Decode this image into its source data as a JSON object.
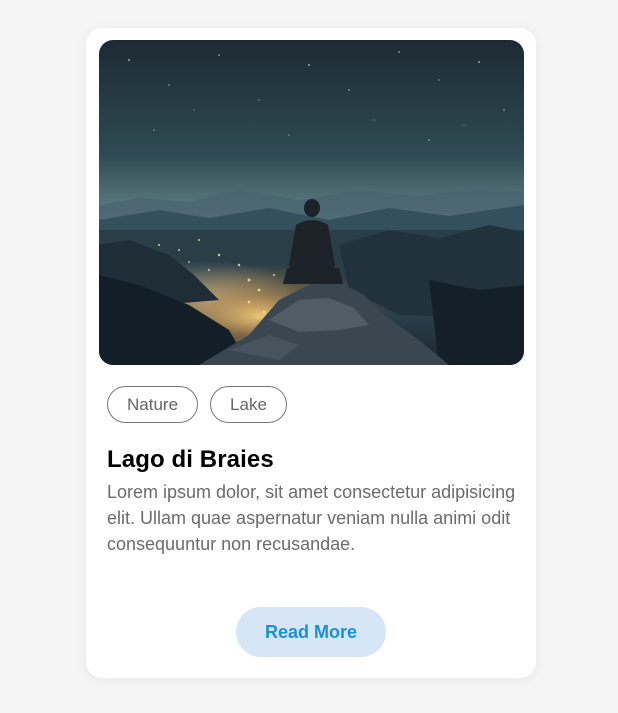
{
  "card": {
    "image_alt": "Person sitting on a mountain rock at night overlooking city lights",
    "tags": [
      "Nature",
      "Lake"
    ],
    "title": "Lago di Braies",
    "description": "Lorem ipsum dolor, sit amet consectetur adipisicing elit. Ullam quae aspernatur veniam nulla animi odit consequuntur non recusandae.",
    "read_more_label": "Read More"
  },
  "colors": {
    "page_background": "#f5f5f5",
    "card_background": "#ffffff",
    "button_background": "#d6e6f7",
    "button_text": "#1a8fdc",
    "tag_border": "#777777",
    "description_text": "#6b6b6b"
  }
}
